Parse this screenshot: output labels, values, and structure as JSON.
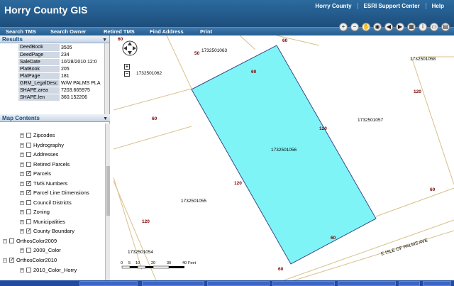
{
  "app": {
    "title": "Horry County GIS",
    "header_links": [
      "Horry County",
      "ESRI Support Center",
      "Help"
    ]
  },
  "toolbar": {
    "items": [
      "Search TMS",
      "Search Owner",
      "Retired TMS",
      "Find Address",
      "Print"
    ]
  },
  "map_tools": [
    "zoom-in-icon",
    "zoom-out-icon",
    "pan-hand-icon",
    "globe-icon",
    "back-arrow-icon",
    "forward-arrow-icon",
    "layers-icon",
    "identify-icon",
    "measure-icon",
    "print-icon"
  ],
  "results": {
    "header": "Results",
    "rows": [
      {
        "key": "DeedBook",
        "value": "3505"
      },
      {
        "key": "DeedPage",
        "value": "234"
      },
      {
        "key": "SaleDate",
        "value": "10/28/2010 12:0"
      },
      {
        "key": "PlatBook",
        "value": "205"
      },
      {
        "key": "PlatPage",
        "value": "181"
      },
      {
        "key": "GRM_LegalDesc",
        "value": "W/W PALMS PLA"
      },
      {
        "key": "SHAPE.area",
        "value": "7203.665975"
      },
      {
        "key": "SHAPE.len",
        "value": "360.152206"
      }
    ]
  },
  "contents": {
    "header": "Map Contents",
    "layers": [
      {
        "label": "Zipcodes",
        "checked": false
      },
      {
        "label": "Hydrography",
        "checked": false
      },
      {
        "label": "Addresses",
        "checked": false
      },
      {
        "label": "Retired Parcels",
        "checked": false
      },
      {
        "label": "Parcels",
        "checked": true
      },
      {
        "label": "TMS Numbers",
        "checked": true
      },
      {
        "label": "Parcel Line Dimensions",
        "checked": true
      },
      {
        "label": "Council Districts",
        "checked": false
      },
      {
        "label": "Zoning",
        "checked": false
      },
      {
        "label": "Municipalities",
        "checked": false
      },
      {
        "label": "County Boundary",
        "checked": true
      }
    ],
    "groups": [
      {
        "label": "OrthosColor2009",
        "checked": false,
        "child": "2009_Color",
        "child_checked": false
      },
      {
        "label": "OrthosColor2010",
        "checked": true,
        "child": "2010_Color_Horry",
        "child_checked": false
      }
    ]
  },
  "map": {
    "highlight_color": "#7ff4f7",
    "parcel_line_color": "#d8c08a",
    "parcels": [
      "1732501063",
      "1732501062",
      "1732501058",
      "1732501056",
      "1732501057",
      "1732501055",
      "1732501054"
    ],
    "dimensions": [
      "60",
      "50",
      "60",
      "60",
      "120",
      "120",
      "120",
      "60",
      "120",
      "60",
      "60",
      "60"
    ],
    "street": "E ISLE OF PALMS AVE",
    "scale": {
      "ticks": [
        "0",
        "5",
        "10",
        "20",
        "30",
        "40"
      ],
      "unit": "Feet"
    }
  },
  "taskbar": {
    "tasks": [
      "",
      "",
      "",
      "",
      "",
      "",
      ""
    ]
  }
}
